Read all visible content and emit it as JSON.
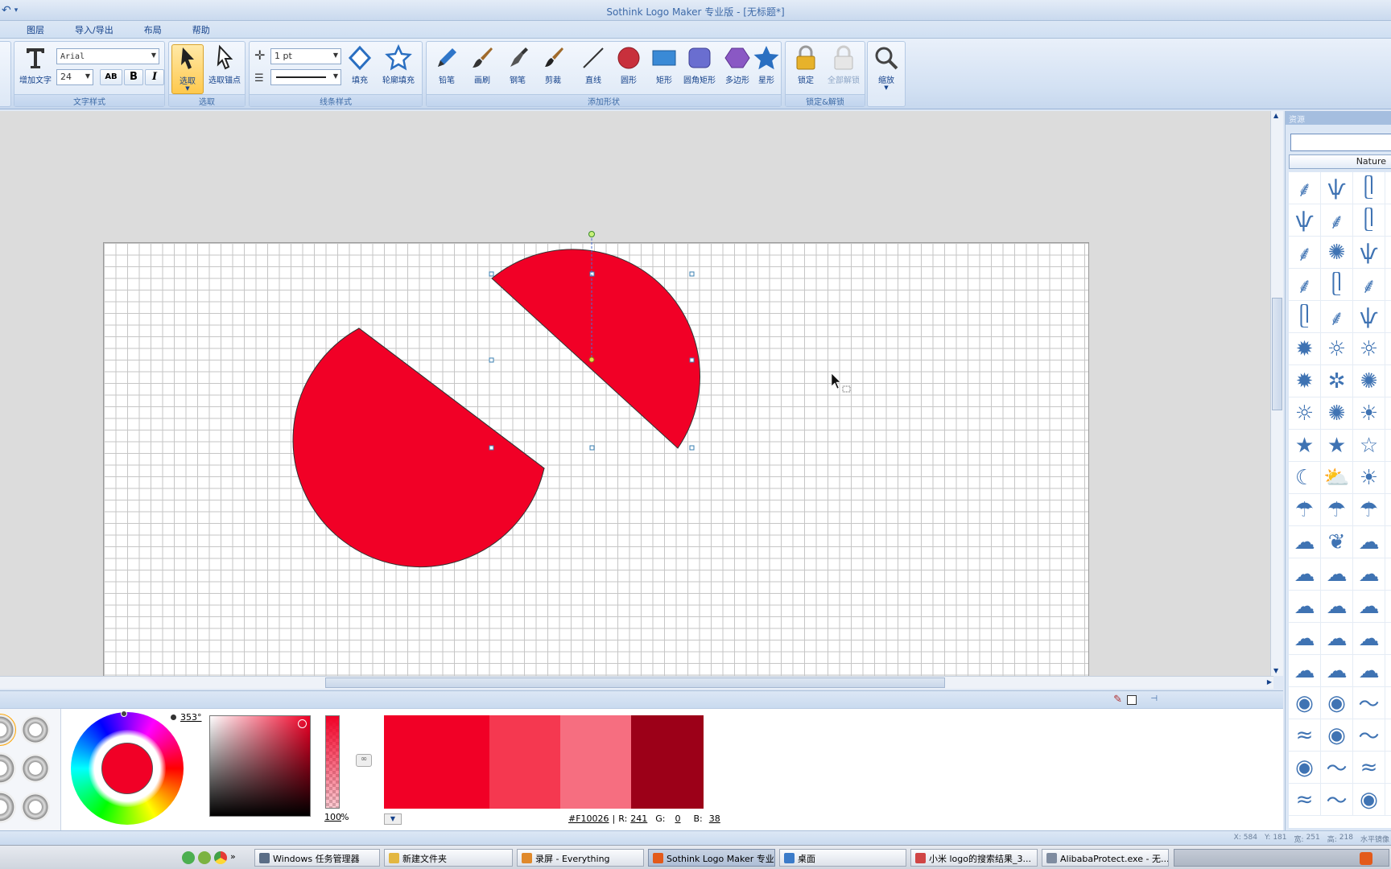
{
  "window": {
    "title": "Sothink Logo Maker 专业版 - [无标题*]"
  },
  "menu": [
    "图层",
    "导入/导出",
    "布局",
    "帮助"
  ],
  "ribbon": {
    "text_style": {
      "add_text": "增加文字",
      "font": "Arial",
      "size": "24",
      "group_label": "文字样式"
    },
    "select": {
      "select": "选取",
      "select_anchor": "选取锚点",
      "group_label": "选取"
    },
    "line_style": {
      "width": "1 pt",
      "fill": "填充",
      "outline_fill": "轮廓填充",
      "group_label": "线条样式"
    },
    "add_shape": {
      "pencil": "铅笔",
      "brush": "画刷",
      "pen": "钢笔",
      "scissors": "剪裁",
      "line": "直线",
      "circle": "圆形",
      "rect": "矩形",
      "round_rect": "圆角矩形",
      "polygon": "多边形",
      "star": "星形",
      "group_label": "添加形状"
    },
    "lock": {
      "lock": "锁定",
      "unlock_all": "全部解锁",
      "group_label": "锁定&解锁"
    },
    "zoom": {
      "label": "缩放"
    }
  },
  "resources": {
    "title": "资源",
    "search_value": "",
    "category": "Nature"
  },
  "color": {
    "hue": "353°",
    "opacity": "100",
    "opacity_unit": "%",
    "hex": "#F10026",
    "r_label": "R:",
    "r": "241",
    "g_label": "G:",
    "g": "0",
    "b_label": "B:",
    "b": "38",
    "swatches": [
      "#f10026",
      "#f53850",
      "#f66e80",
      "#9c0018"
    ],
    "main_fill": "#f10026"
  },
  "status": {
    "x_label": "X:",
    "x": "584",
    "y_label": "Y:",
    "y": "181",
    "w_label": "宽:",
    "w": "251",
    "h_label": "高:",
    "h": "218",
    "extra": "水平镜像"
  },
  "taskbar": [
    {
      "label": "Windows 任务管理器",
      "color": "#5a6d86"
    },
    {
      "label": "新建文件夹",
      "color": "#e3b741"
    },
    {
      "label": "录屏 - Everything",
      "color": "#e0892b"
    },
    {
      "label": "Sothink Logo Maker 专业...",
      "color": "#e35a1a",
      "active": true
    },
    {
      "label": "桌面",
      "color": "#3b7bc9"
    },
    {
      "label": "小米 logo的搜索结果_3...",
      "color": "#d04545"
    },
    {
      "label": "AlibabaProtect.exe - 无...",
      "color": "#7f8ca0"
    }
  ]
}
